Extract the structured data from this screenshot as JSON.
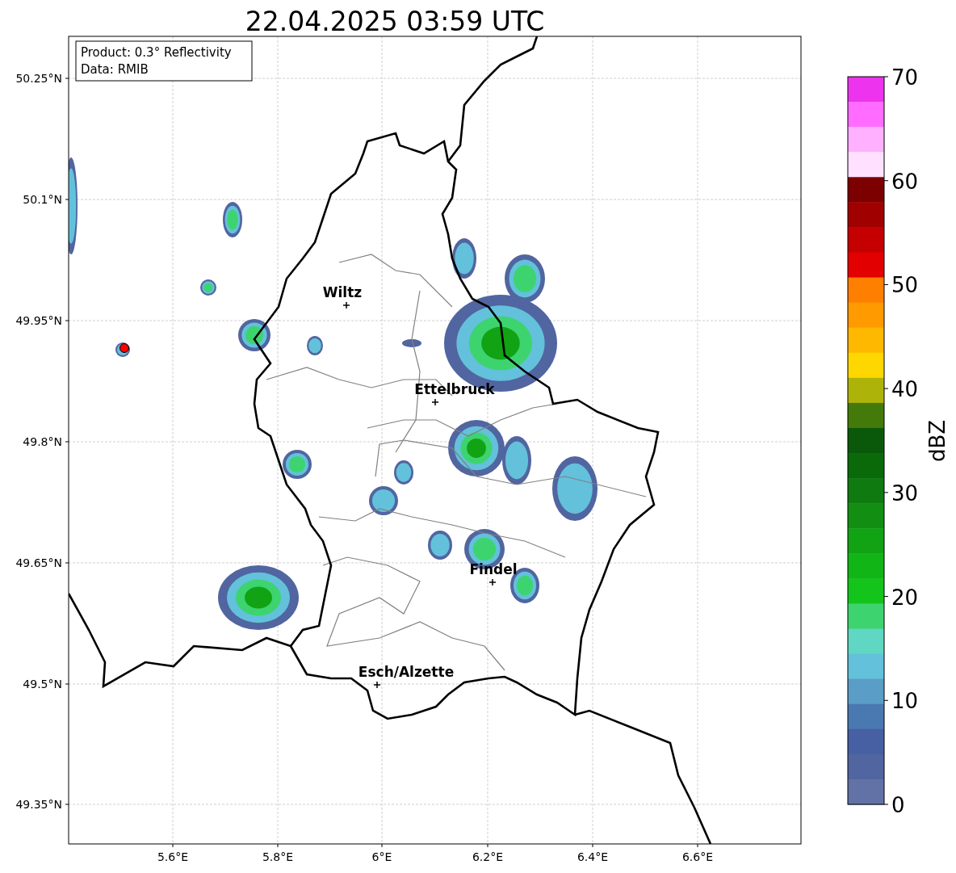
{
  "title": "22.04.2025 03:59 UTC",
  "info_box": {
    "lines": [
      "Product: 0.3° Reflectivity",
      "Data: RMIB"
    ]
  },
  "map": {
    "x_ticks": [
      "5.6°E",
      "5.8°E",
      "6°E",
      "6.2°E",
      "6.4°E",
      "6.6°E"
    ],
    "y_ticks": [
      "50.25°N",
      "50.1°N",
      "49.95°N",
      "49.8°N",
      "49.65°N",
      "49.5°N",
      "49.35°N"
    ],
    "cities": [
      {
        "name": "Wiltz"
      },
      {
        "name": "Ettelbruck"
      },
      {
        "name": "Findel"
      },
      {
        "name": "Esch/Alzette"
      }
    ]
  },
  "colorbar": {
    "label": "dBZ",
    "ticks": [
      "70",
      "60",
      "50",
      "40",
      "30",
      "20",
      "10",
      "0"
    ],
    "bins": [
      {
        "color": "#ee33ee"
      },
      {
        "color": "#ff6cff"
      },
      {
        "color": "#ffb0ff"
      },
      {
        "color": "#ffe1ff"
      },
      {
        "color": "#7c0000"
      },
      {
        "color": "#a00000"
      },
      {
        "color": "#c40000"
      },
      {
        "color": "#e30000"
      },
      {
        "color": "#ff7f00"
      },
      {
        "color": "#ff9a00"
      },
      {
        "color": "#ffb800"
      },
      {
        "color": "#ffd700"
      },
      {
        "color": "#aeb30a"
      },
      {
        "color": "#437a0a"
      },
      {
        "color": "#0a590a"
      },
      {
        "color": "#0a6a0a"
      },
      {
        "color": "#0f7a0f"
      },
      {
        "color": "#128e12"
      },
      {
        "color": "#11a314"
      },
      {
        "color": "#11b515"
      },
      {
        "color": "#13c41b"
      },
      {
        "color": "#3dd46f"
      },
      {
        "color": "#5fd7c2"
      },
      {
        "color": "#63c1db"
      },
      {
        "color": "#5a9dc6"
      },
      {
        "color": "#4a78b0"
      },
      {
        "color": "#4660a3"
      },
      {
        "color": "#5165a0"
      },
      {
        "color": "#6272a6"
      }
    ]
  }
}
